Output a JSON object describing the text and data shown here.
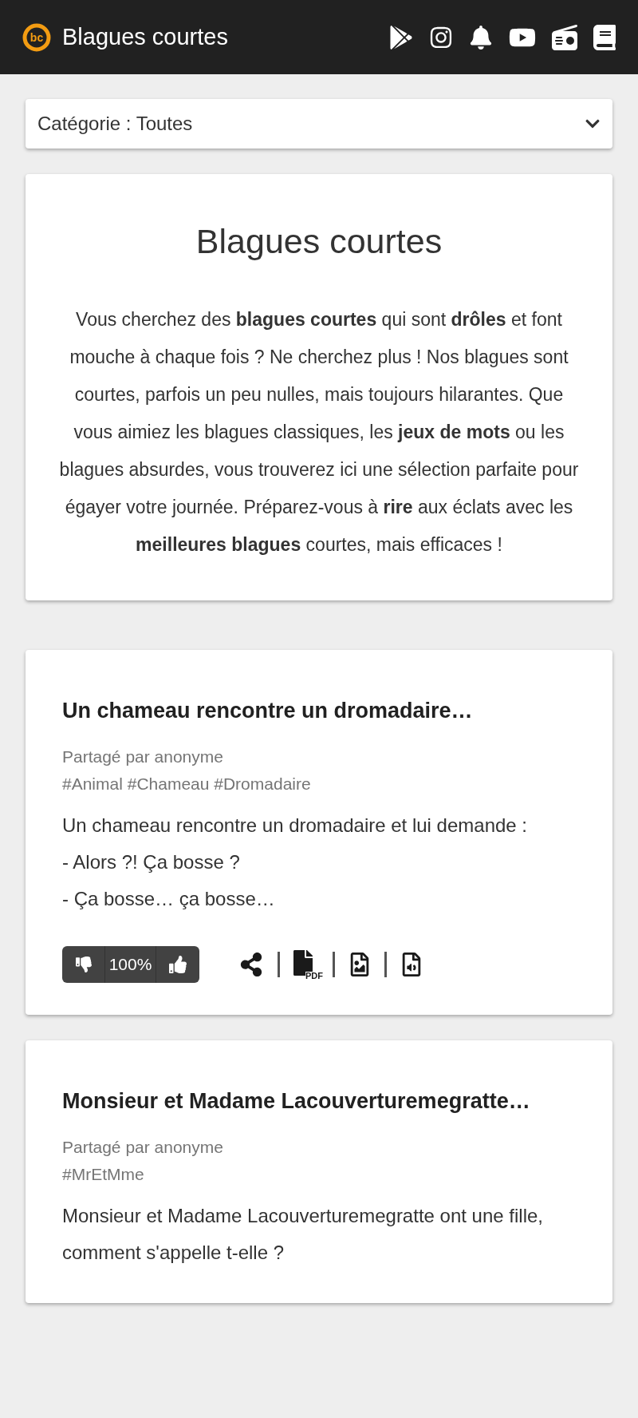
{
  "header": {
    "logo_text": "bc",
    "title": "Blagues courtes"
  },
  "category_select": {
    "value": "Catégorie : Toutes"
  },
  "intro": {
    "title": "Blagues courtes",
    "text": "Vous cherchez des **blagues courtes** qui sont **drôles** et font mouche à chaque fois ? Ne cherchez plus ! Nos blagues sont courtes, parfois un peu nulles, mais toujours hilarantes. Que vous aimiez les blagues classiques, les **jeux de mots** ou les blagues absurdes, vous trouverez ici une sélection parfaite pour égayer votre journée. Préparez-vous à **rire** aux éclats avec les **meilleures blagues** courtes, mais efficaces !"
  },
  "jokes": [
    {
      "title": "Un chameau rencontre un dromadaire…",
      "author": "Partagé par anonyme",
      "tags": "#Animal #Chameau #Dromadaire",
      "lines": [
        "Un chameau rencontre un dromadaire et lui demande :",
        "- Alors ?! Ça bosse ?",
        "- Ça bosse… ça bosse…"
      ],
      "score": "100%",
      "pdf_label": "PDF"
    },
    {
      "title": "Monsieur et Madame Lacouverturemegratte…",
      "author": "Partagé par anonyme",
      "tags": "#MrEtMme",
      "lines": [
        "Monsieur et Madame Lacouverturemegratte ont une fille, comment s'appelle t-elle ?"
      ]
    }
  ]
}
